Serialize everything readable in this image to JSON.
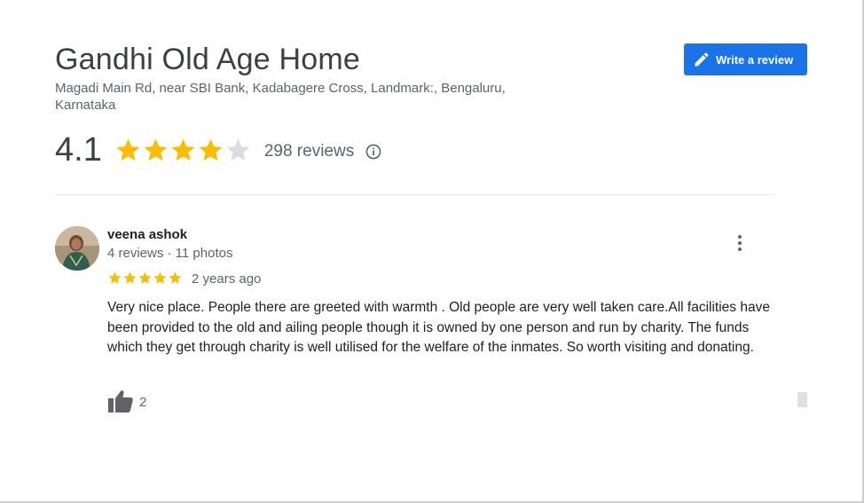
{
  "place": {
    "name": "Gandhi Old Age Home",
    "address": "Magadi Main Rd, near SBI Bank, Kadabagere Cross, Landmark:, Bengaluru, Karnataka"
  },
  "write_review": {
    "label": "Write a review",
    "icon": "pencil-icon"
  },
  "summary": {
    "rating": "4.1",
    "rating_value": 4.1,
    "stars_max": 5,
    "review_count": "298 reviews",
    "info_icon": "info-icon"
  },
  "review": {
    "reviewer_name": "veena ashok",
    "reviewer_meta": "4 reviews · 11 photos",
    "stars": 5,
    "date": "2 years ago",
    "text": "Very nice place. People there are greeted with warmth . Old people are very well taken care.All facilities have been provided to the old and ailing people though it is owned by one person and run by charity. The funds which they get through charity is well utilised for the welfare of the inmates. So worth visiting and donating.",
    "likes": "2",
    "like_icon": "thumbs-up-icon",
    "more_icon": "more-vert-icon"
  },
  "colors": {
    "accent": "#1a73e8",
    "star_filled": "#fbbc04",
    "star_empty": "#dadce0",
    "text_primary": "#202124",
    "text_secondary": "#5f6368"
  }
}
